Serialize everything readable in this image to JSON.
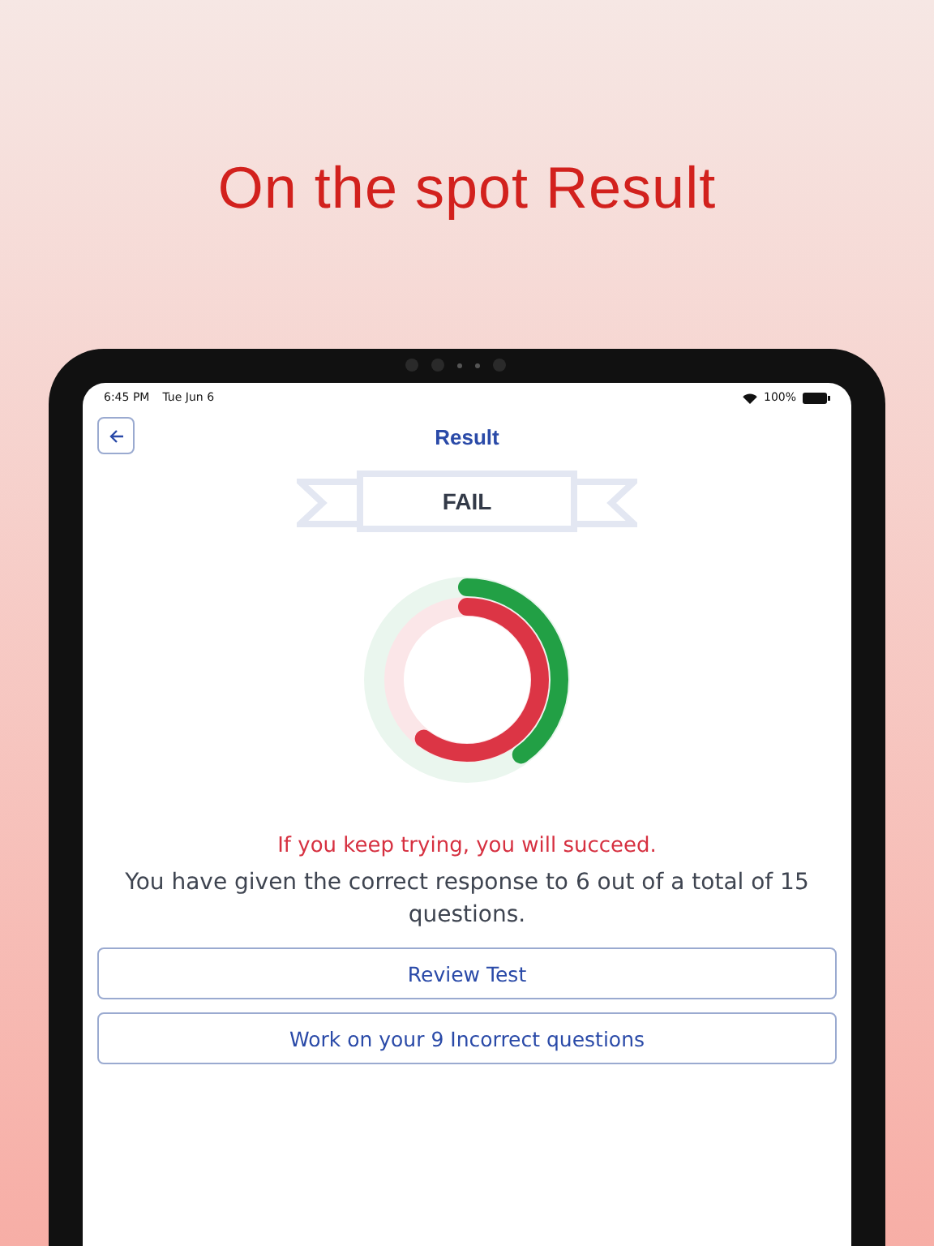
{
  "headline": "On the spot Result",
  "status_bar": {
    "time": "6:45 PM",
    "date": "Tue Jun 6",
    "battery": "100%"
  },
  "nav": {
    "title": "Result"
  },
  "banner": {
    "label": "FAIL"
  },
  "score_ring": {
    "correct": {
      "level": 0.4,
      "color": "#22a045"
    },
    "incorrect": {
      "level": 0.6,
      "color": "#dc3545"
    }
  },
  "message": "If you keep trying, you will succeed.",
  "summary": "You have given the correct response to 6 out of a total of 15 questions.",
  "buttons": [
    "Review Test",
    "Work on your 9 Incorrect questions"
  ]
}
